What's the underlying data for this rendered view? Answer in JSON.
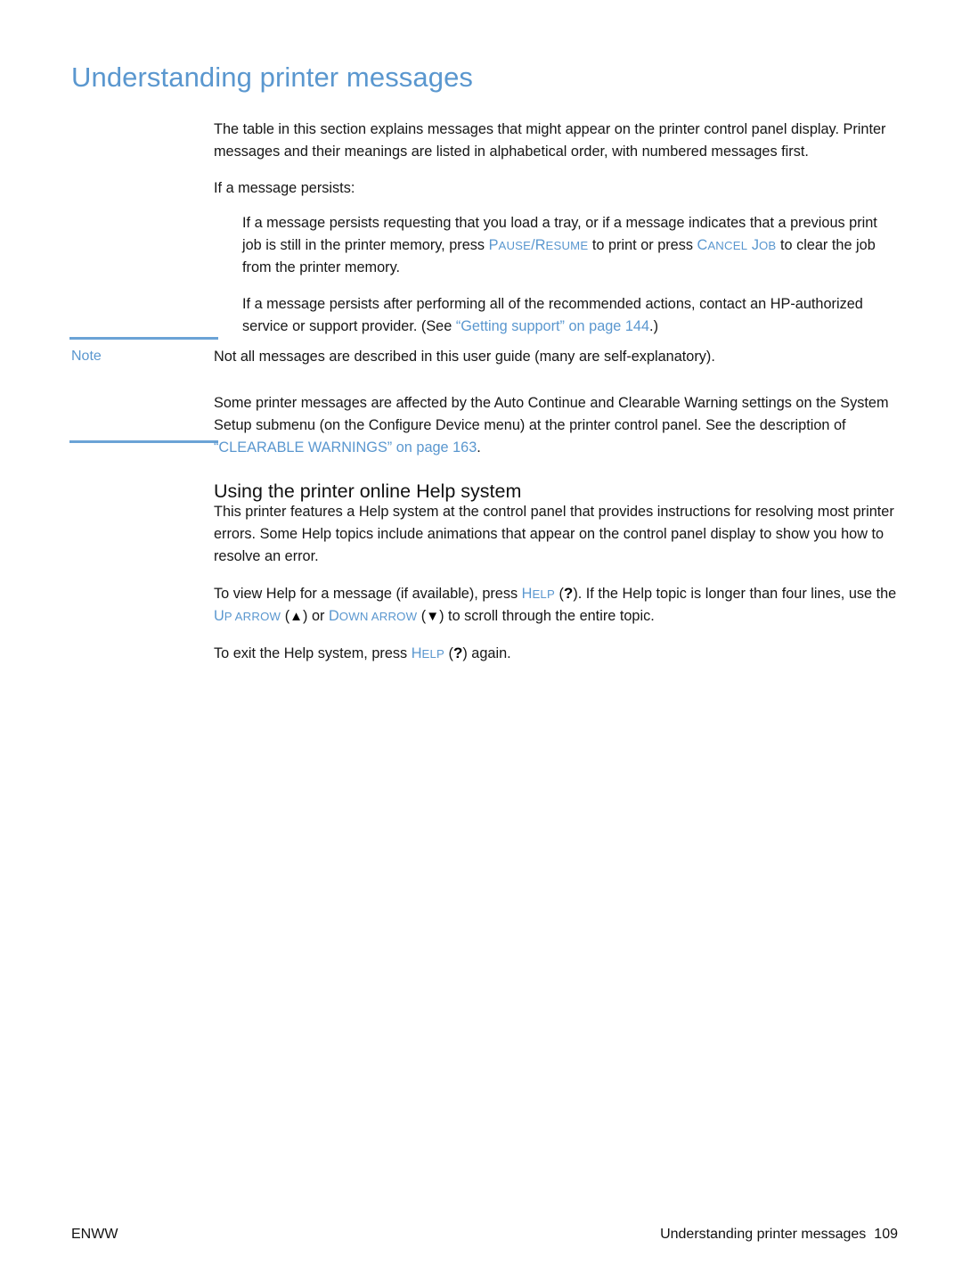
{
  "document": {
    "title": "Understanding printer messages",
    "accent_color": "#5a97cf",
    "rule_color": "#6ba3d6",
    "text_color": "#161616"
  },
  "heading": {
    "text": "Understanding printer messages"
  },
  "intro": {
    "paragraph_1": "The table in this section explains messages that might appear on the printer control panel display. Printer messages and their meanings are listed in alphabetical order, with numbered messages first.",
    "paragraph_2": "If a message persists:"
  },
  "persist_items": {
    "item_1": {
      "text_before_key1": "If a message persists requesting that you load a tray, or if a message indicates that a previous print job is still in the printer memory, press ",
      "key_1_initial": "P",
      "key_1_rest": "AUSE",
      "key_1_sep": "/",
      "key_1b_initial": "R",
      "key_1b_rest": "ESUME",
      "text_middle": " to print or press ",
      "key_2_initial": "C",
      "key_2_rest": "ANCEL",
      "key_2b_initial": " J",
      "key_2b_rest": "OB",
      "text_after": " to clear the job from the printer memory."
    },
    "item_2": {
      "text_before_link": "If a message persists after performing all of the recommended actions, contact an HP-authorized service or support provider. (See ",
      "link_text": "“Getting support” on page 144",
      "text_after_link": ".)"
    }
  },
  "note": {
    "label": "Note",
    "paragraph_1": "Not all messages are described in this user guide (many are self-explanatory).",
    "paragraph_2_before_link": "Some printer messages are affected by the Auto Continue and Clearable Warning settings on the System Setup submenu (on the Configure Device menu) at the printer control panel. See the description of ",
    "paragraph_2_link": "“CLEARABLE WARNINGS” on page 163",
    "paragraph_2_after_link": "."
  },
  "help_section": {
    "heading": "Using the printer online Help system",
    "paragraph_1": "This printer features a Help system at the control panel that provides instructions for resolving most printer errors. Some Help topics include animations that appear on the control panel display to show you how to resolve an error.",
    "paragraph_2": {
      "text_1": "To view Help for a message (if available), press ",
      "help_key_initial": "H",
      "help_key_rest": "ELP",
      "paren_open": " (",
      "help_glyph": "?",
      "paren_close": "). ",
      "text_2": "If the Help topic is longer than four lines, use the ",
      "up_key_initial": "U",
      "up_key_rest": "P ARROW",
      "up_paren_open": " (",
      "up_glyph": "▲",
      "up_paren_close": ") ",
      "text_3": "or ",
      "down_key_initial": "D",
      "down_key_rest": "OWN ARROW",
      "down_paren_open": " (",
      "down_glyph": "▼",
      "down_paren_close": ") ",
      "text_4": "to scroll through the entire topic."
    },
    "paragraph_3": {
      "text_1": "To exit the Help system, press ",
      "help_key_initial": "H",
      "help_key_rest": "ELP",
      "paren_open": " (",
      "help_glyph": "?",
      "paren_close": ") ",
      "text_2": "again."
    }
  },
  "footer": {
    "left": "ENWW",
    "right_title": "Understanding printer messages",
    "page_number": "109"
  }
}
